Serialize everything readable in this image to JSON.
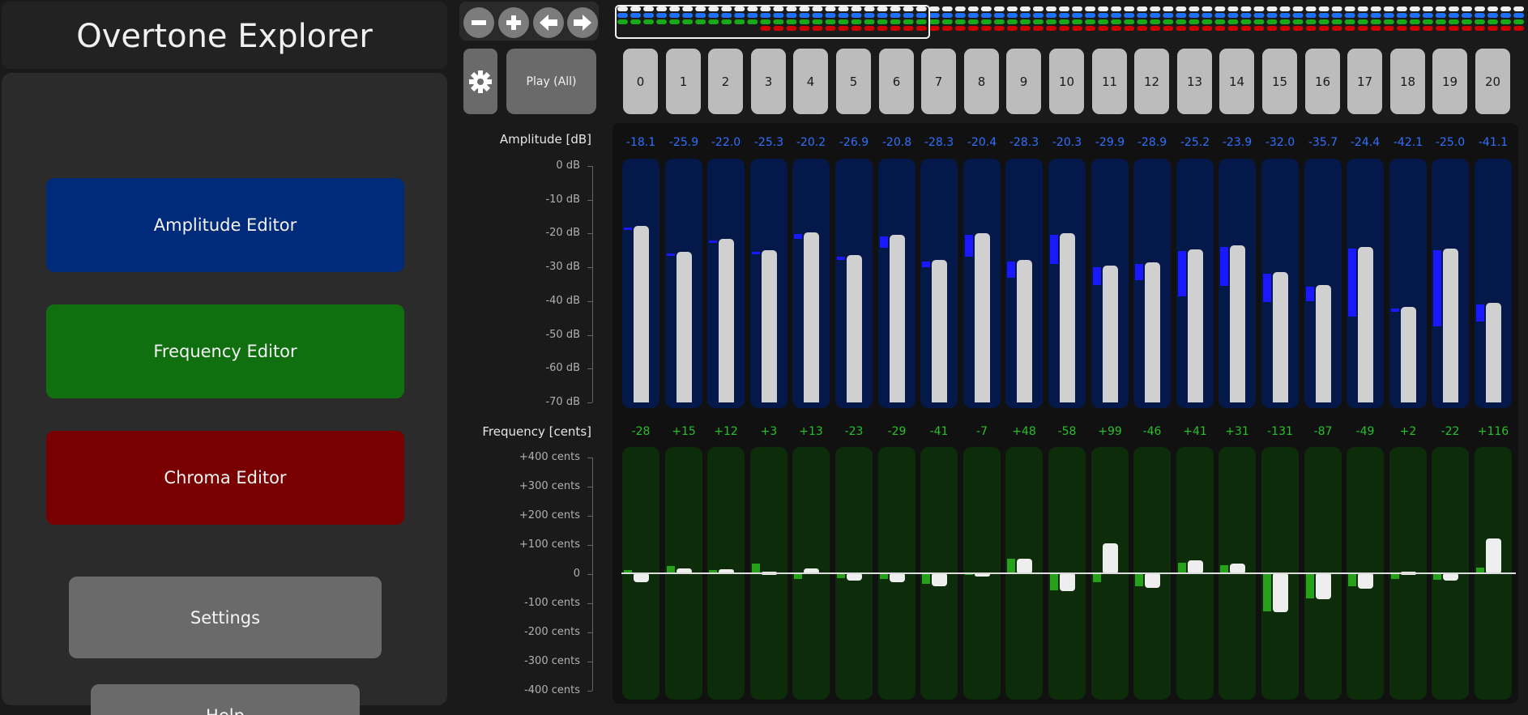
{
  "app": {
    "title": "Overtone Explorer"
  },
  "nav": {
    "amplitude_editor": "Amplitude Editor",
    "frequency_editor": "Frequency Editor",
    "chroma_editor": "Chroma Editor",
    "settings": "Settings",
    "help": "Help"
  },
  "toolbar": {
    "icons": [
      "minus-icon",
      "plus-icon",
      "arrow-left-icon",
      "arrow-right-icon",
      "gear-icon"
    ],
    "play_all": "Play (All)"
  },
  "partials": [
    "0",
    "1",
    "2",
    "3",
    "4",
    "5",
    "6",
    "7",
    "8",
    "9",
    "10",
    "11",
    "12",
    "13",
    "14",
    "15",
    "16",
    "17",
    "18",
    "19",
    "20"
  ],
  "amplitude": {
    "label": "Amplitude [dB]",
    "ticks": [
      "0 dB",
      "-10 dB",
      "-20 dB",
      "-30 dB",
      "-40 dB",
      "-50 dB",
      "-60 dB",
      "-70 dB"
    ],
    "range_db": [
      -70,
      0
    ],
    "values": [
      "-18.1",
      "-25.9",
      "-22.0",
      "-25.3",
      "-20.2",
      "-26.9",
      "-20.8",
      "-28.3",
      "-20.4",
      "-28.3",
      "-20.3",
      "-29.9",
      "-28.9",
      "-25.2",
      "-23.9",
      "-32.0",
      "-35.7",
      "-24.4",
      "-42.1",
      "-25.0",
      "-41.1"
    ],
    "reference_db": [
      -18.1,
      -25.9,
      -22.0,
      -25.3,
      -21.5,
      -27.7,
      -24.3,
      -30.0,
      -26.8,
      -33.2,
      -29.1,
      -35.2,
      -33.9,
      -38.7,
      -35.6,
      -40.2,
      -40.1,
      -44.5,
      -43.2,
      -47.5,
      -46.0
    ]
  },
  "frequency": {
    "label": "Frequency [cents]",
    "ticks": [
      "+400 cents",
      "+300 cents",
      "+200 cents",
      "+100 cents",
      "0",
      "-100 cents",
      "-200 cents",
      "-300 cents",
      "-400 cents"
    ],
    "range_cents": [
      -400,
      400
    ],
    "values": [
      "-28",
      "+15",
      "+12",
      "+3",
      "+13",
      "-23",
      "-29",
      "-41",
      "-7",
      "+48",
      "-58",
      "+99",
      "-46",
      "+41",
      "+31",
      "-131",
      "-87",
      "-49",
      "+2",
      "-22",
      "+116"
    ],
    "reference_cents": [
      10,
      25,
      10,
      34,
      -20,
      -18,
      -20,
      -35,
      -5,
      50,
      -58,
      -30,
      -45,
      35,
      28,
      -130,
      -87,
      -45,
      -20,
      -22,
      20
    ]
  },
  "colors": {
    "amp_track": "#05184a",
    "amp_mark": "#1a18ff",
    "amp_text": "#2f70ff",
    "freq_track": "#0c2c0a",
    "freq_mark": "#27a01a",
    "freq_text": "#28c028",
    "strip_row1": "#f0f0f0",
    "strip_row2": "#1f70ff",
    "strip_row3": "#18a81a",
    "strip_row4": "#cc0000"
  }
}
